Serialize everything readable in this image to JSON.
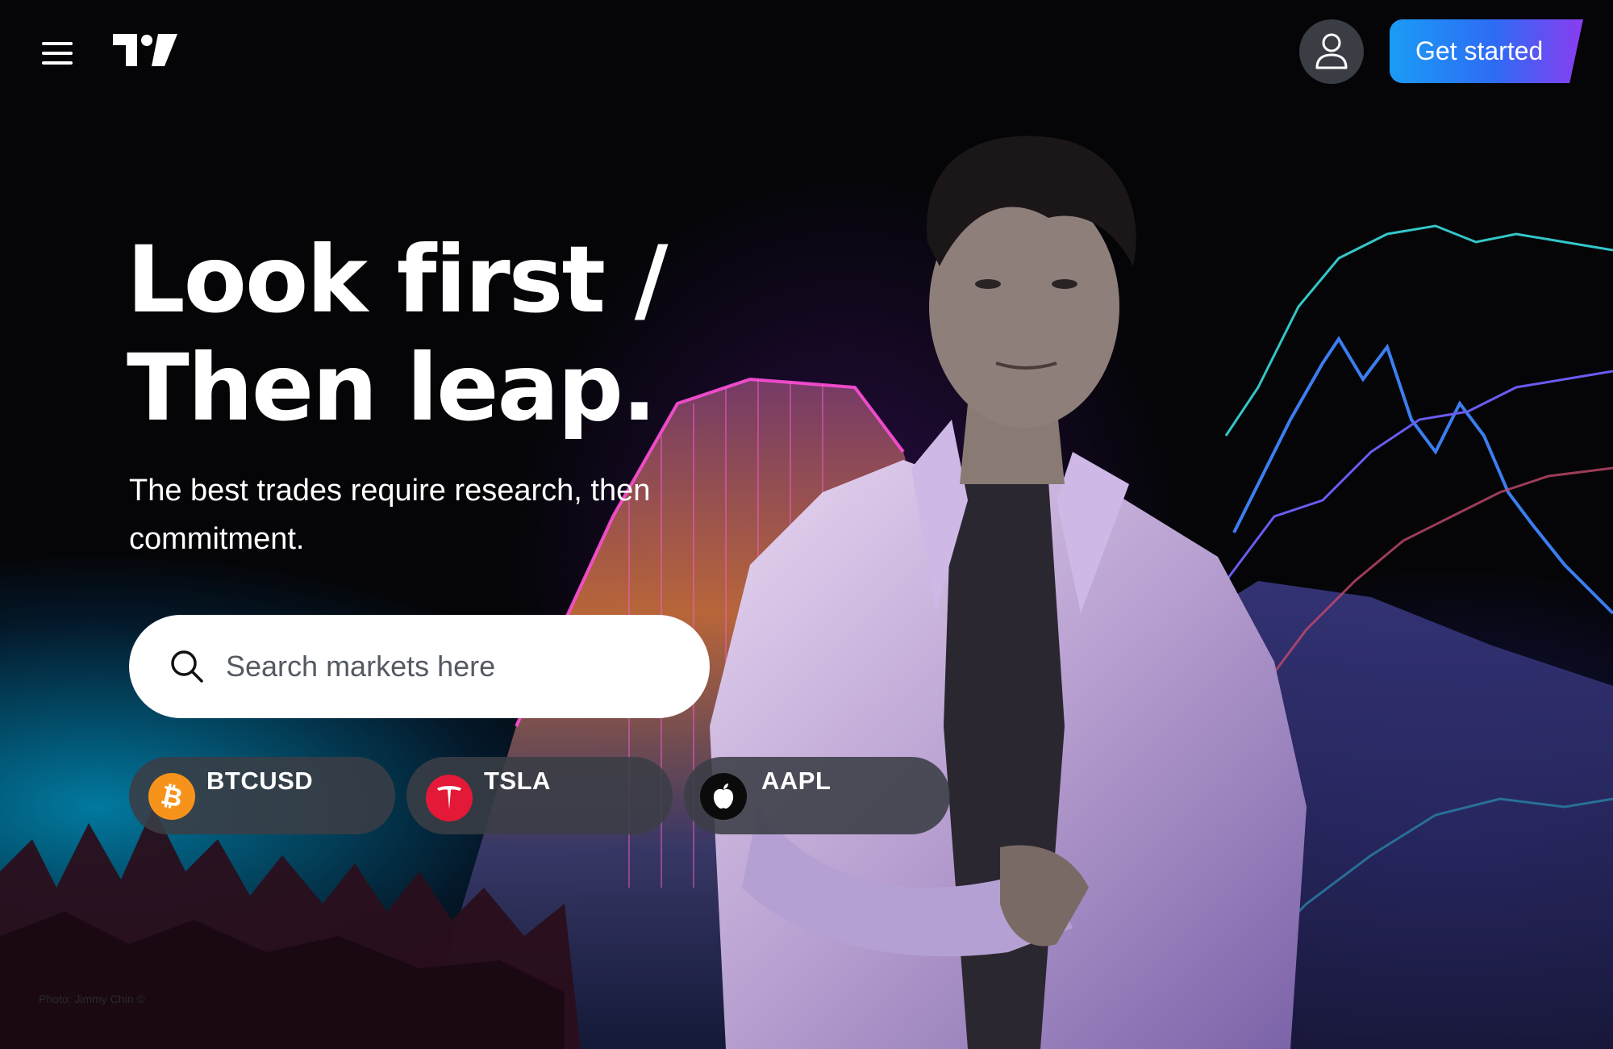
{
  "header": {
    "menu_label": "Menu",
    "logo_text": "TV",
    "get_started_label": "Get started"
  },
  "hero": {
    "headline_line1": "Look first /",
    "headline_line2": "Then leap.",
    "subtitle": "The best trades require research, then commitment."
  },
  "search": {
    "placeholder": "Search markets here",
    "value": ""
  },
  "tickers": [
    {
      "symbol": "BTCUSD",
      "icon": "bitcoin-icon",
      "icon_color": "#f7931a"
    },
    {
      "symbol": "TSLA",
      "icon": "tesla-icon",
      "icon_color": "#e31937"
    },
    {
      "symbol": "AAPL",
      "icon": "apple-icon",
      "icon_color": "#000000"
    }
  ],
  "footer": {
    "photo_credit": "Photo: Jimmy Chin ©"
  },
  "colors": {
    "accent_start": "#1a9cf5",
    "accent_end": "#8a3cf0",
    "background": "#050508",
    "chip_background": "#3a3e46"
  }
}
